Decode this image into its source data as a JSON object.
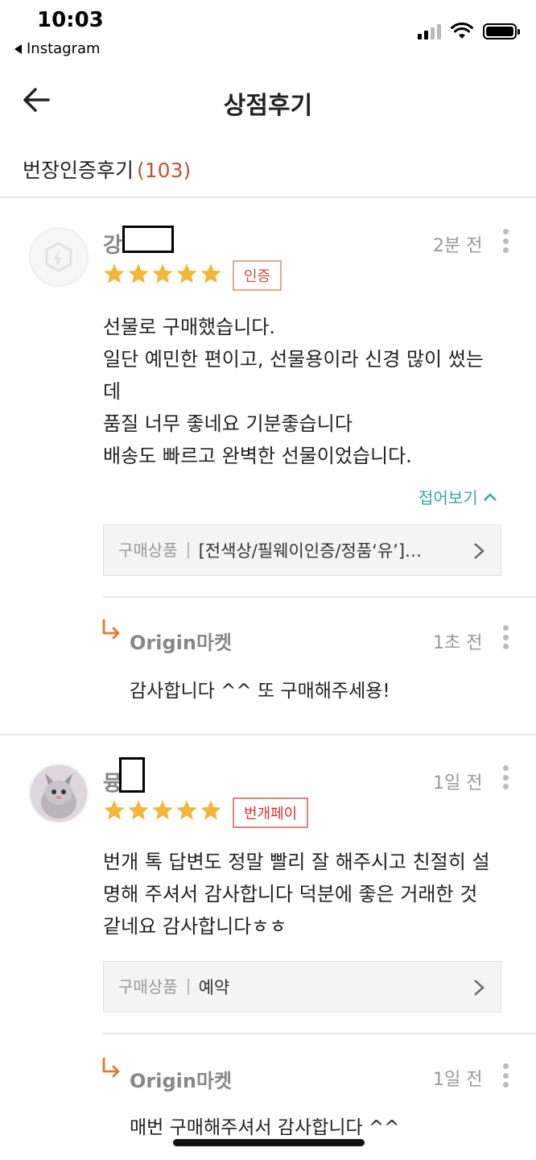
{
  "status_bar": {
    "time": "10:03",
    "back_app": "Instagram"
  },
  "header": {
    "title": "상점후기"
  },
  "tab": {
    "label": "번장인증후기",
    "count": "(103)"
  },
  "reviews": [
    {
      "name_initial": "강",
      "time": "2분 전",
      "rating": 5,
      "badge": "인증",
      "body_lines": [
        "선물로 구매했습니다.",
        "일단 예민한 편이고, 선물용이라 신경 많이 썼는",
        "데",
        "품질 너무 좋네요  기분좋습니다",
        "배송도 빠르고 완벽한 선물이었습니다."
      ],
      "collapse_label": "접어보기",
      "product_label": "구매상품",
      "product_name": "[전색상/필웨이인증/정품‘유’]…",
      "reply": {
        "seller": "Origin마켓",
        "time": "1초 전",
        "text": "감사합니다 ^^ 또 구매해주세용!"
      }
    },
    {
      "name_initial": "뮹",
      "time": "1일 전",
      "rating": 5,
      "badge": "번개페이",
      "body_lines": [
        "번개 톡 답변도 정말 빨리 잘 해주시고 친절히 설",
        "명해 주셔서 감사합니다 덕분에 좋은 거래한 것",
        "같네요 감사합니다ㅎㅎ"
      ],
      "product_label": "구매상품",
      "product_name": "예약",
      "reply": {
        "seller": "Origin마켓",
        "time": "1일 전",
        "text": "매번 구매해주셔서 감사합니다 ^^"
      }
    }
  ],
  "colors": {
    "accent_teal": "#3aa89a",
    "count_red": "#c0533a",
    "star": "#f3b53a"
  }
}
